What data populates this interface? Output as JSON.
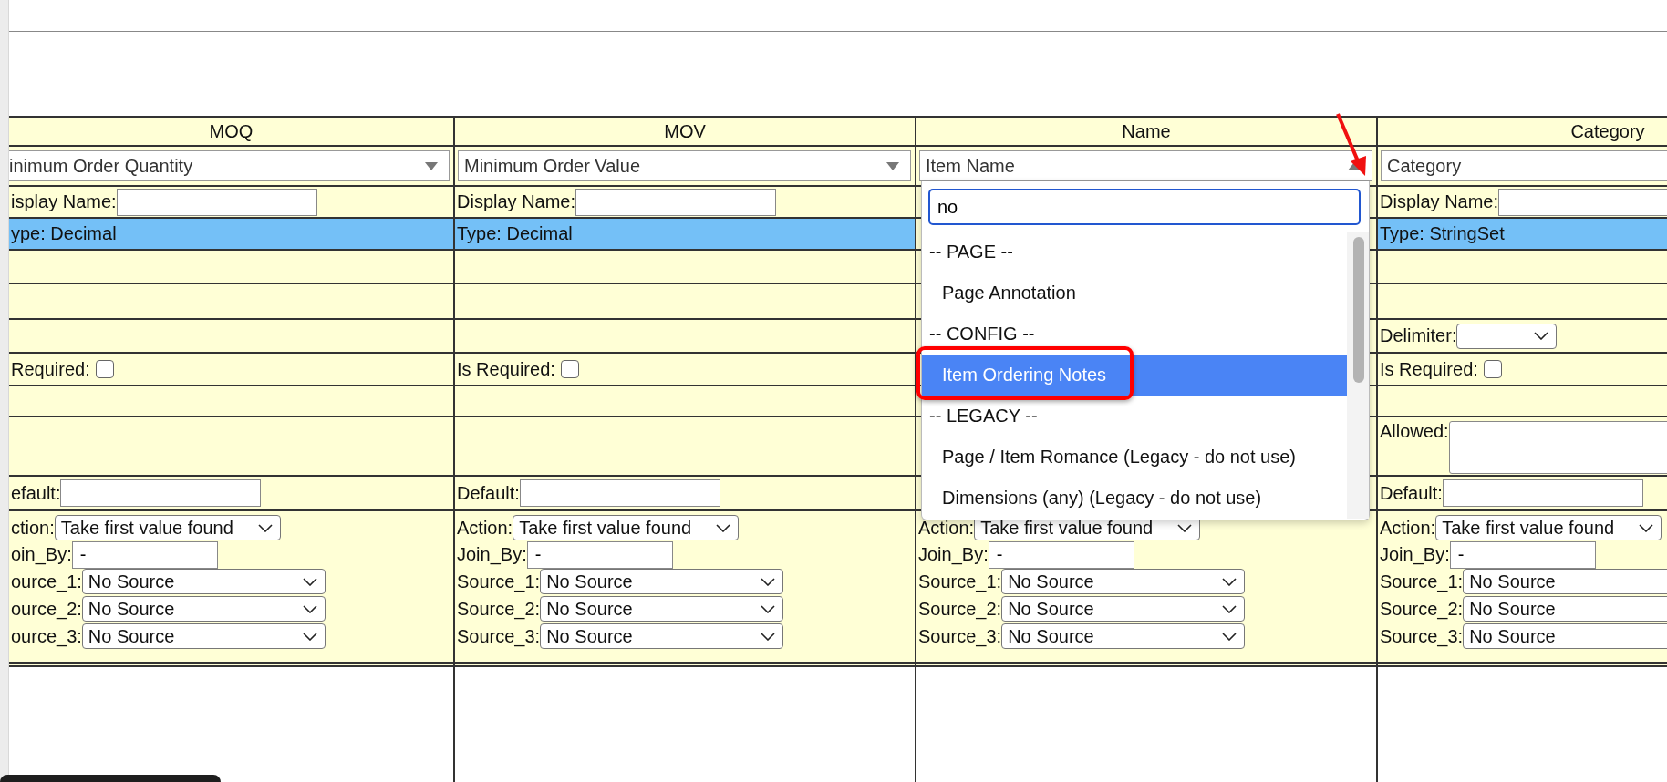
{
  "columns": [
    {
      "header": "MOQ",
      "mapping": {
        "value": "inimum Order Quantity",
        "expanded": false
      },
      "cells": [
        {
          "kind": "input",
          "label": "isplay Name:"
        },
        {
          "kind": "type",
          "label": "ype: Decimal"
        },
        {
          "kind": "empty"
        },
        {
          "kind": "empty"
        },
        {
          "kind": "empty"
        },
        {
          "kind": "checkbox",
          "label": "Required:",
          "checked": false
        },
        {
          "kind": "empty"
        },
        {
          "kind": "empty"
        },
        {
          "kind": "input",
          "label": "efault:"
        }
      ],
      "action": {
        "label": "ction:",
        "value": "Take first value found"
      },
      "join_by": {
        "label": "oin_By:",
        "value": "-"
      },
      "sources": [
        {
          "label": "ource_1:",
          "value": "No Source"
        },
        {
          "label": "ource_2:",
          "value": "No Source"
        },
        {
          "label": "ource_3:",
          "value": "No Source"
        }
      ]
    },
    {
      "header": "MOV",
      "mapping": {
        "value": "Minimum Order Value",
        "expanded": false
      },
      "cells": [
        {
          "kind": "input",
          "label": "Display Name:"
        },
        {
          "kind": "type",
          "label": "Type: Decimal"
        },
        {
          "kind": "empty"
        },
        {
          "kind": "empty"
        },
        {
          "kind": "empty"
        },
        {
          "kind": "checkbox",
          "label": "Is Required:",
          "checked": false
        },
        {
          "kind": "empty"
        },
        {
          "kind": "empty"
        },
        {
          "kind": "input",
          "label": "Default:"
        }
      ],
      "action": {
        "label": "Action:",
        "value": "Take first value found"
      },
      "join_by": {
        "label": "Join_By:",
        "value": "-"
      },
      "sources": [
        {
          "label": "Source_1:",
          "value": "No Source"
        },
        {
          "label": "Source_2:",
          "value": "No Source"
        },
        {
          "label": "Source_3:",
          "value": "No Source"
        }
      ]
    },
    {
      "header": "Name",
      "mapping": {
        "value": "Item Name",
        "expanded": true,
        "annotated": true
      },
      "cells": [
        {
          "kind": "empty"
        },
        {
          "kind": "empty"
        },
        {
          "kind": "empty"
        },
        {
          "kind": "empty"
        },
        {
          "kind": "empty"
        },
        {
          "kind": "empty"
        },
        {
          "kind": "empty"
        },
        {
          "kind": "empty"
        },
        {
          "kind": "empty"
        }
      ],
      "action": {
        "label": "Action:",
        "value": "Take first value found"
      },
      "join_by": {
        "label": "Join_By:",
        "value": "-"
      },
      "sources": [
        {
          "label": "Source_1:",
          "value": "No Source"
        },
        {
          "label": "Source_2:",
          "value": "No Source"
        },
        {
          "label": "Source_3:",
          "value": "No Source"
        }
      ]
    },
    {
      "header": "Category",
      "mapping": {
        "value": "Category"
      },
      "cells": [
        {
          "kind": "input",
          "label": "Display Name:"
        },
        {
          "kind": "type",
          "label": "Type: StringSet"
        },
        {
          "kind": "empty"
        },
        {
          "kind": "empty"
        },
        {
          "kind": "select",
          "label": "Delimiter:"
        },
        {
          "kind": "checkbox",
          "label": "Is Required:",
          "checked": false
        },
        {
          "kind": "empty"
        },
        {
          "kind": "textarea",
          "label": "Allowed:"
        },
        {
          "kind": "input",
          "label": "Default:"
        }
      ],
      "action": {
        "label": "Action:",
        "value": "Take first value found"
      },
      "join_by": {
        "label": "Join_By:",
        "value": "-"
      },
      "sources": [
        {
          "label": "Source_1:",
          "value": "No Source"
        },
        {
          "label": "Source_2:",
          "value": "No Source"
        },
        {
          "label": "Source_3:",
          "value": "No Source"
        }
      ]
    }
  ],
  "dropdown": {
    "search": "no",
    "options": [
      {
        "kind": "group",
        "label": "-- PAGE --",
        "selected": false
      },
      {
        "kind": "option",
        "label": "Page Annotation",
        "selected": false
      },
      {
        "kind": "group",
        "label": "-- CONFIG --",
        "selected": false
      },
      {
        "kind": "option",
        "label": "Item Ordering Notes",
        "selected": true,
        "highlighted": true
      },
      {
        "kind": "group",
        "label": "-- LEGACY --",
        "selected": false
      },
      {
        "kind": "option",
        "label": "Page / Item Romance (Legacy - do not use)",
        "selected": false
      },
      {
        "kind": "option",
        "label": "Dimensions (any) (Legacy - do not use)",
        "selected": false
      }
    ]
  }
}
